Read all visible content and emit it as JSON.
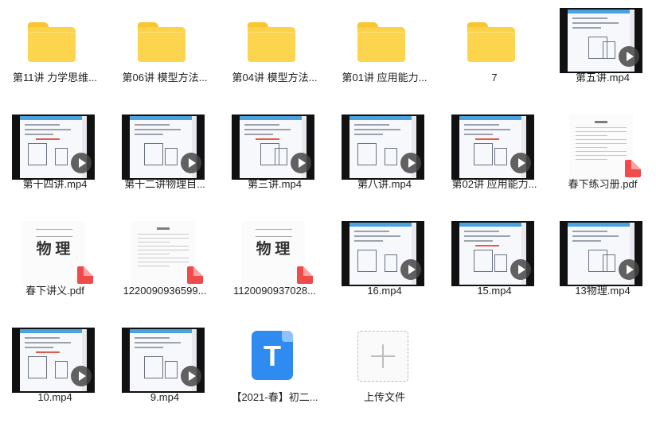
{
  "files": [
    {
      "type": "folder",
      "name": "第11讲 力学思维..."
    },
    {
      "type": "folder",
      "name": "第06讲 模型方法..."
    },
    {
      "type": "folder",
      "name": "第04讲 模型方法..."
    },
    {
      "type": "folder",
      "name": "第01讲 应用能力..."
    },
    {
      "type": "folder",
      "name": "7"
    },
    {
      "type": "video",
      "name": "第五讲.mp4"
    },
    {
      "type": "video",
      "name": "第十四讲.mp4"
    },
    {
      "type": "video",
      "name": "第十二讲物理目..."
    },
    {
      "type": "video",
      "name": "第三讲.mp4"
    },
    {
      "type": "video",
      "name": "第八讲.mp4"
    },
    {
      "type": "video",
      "name": "第02讲 应用能力..."
    },
    {
      "type": "pdf",
      "name": "春下练习册.pdf",
      "cover": "",
      "cover_sub": ""
    },
    {
      "type": "pdf",
      "name": "春下讲义.pdf",
      "cover": "物 理",
      "cover_sub": ""
    },
    {
      "type": "pdf",
      "name": "1220090936599...",
      "cover": "",
      "cover_sub": ""
    },
    {
      "type": "pdf",
      "name": "1120090937028...",
      "cover": "物 理",
      "cover_sub": ""
    },
    {
      "type": "video",
      "name": "16.mp4"
    },
    {
      "type": "video",
      "name": "15.mp4"
    },
    {
      "type": "video",
      "name": "13物理.mp4"
    },
    {
      "type": "video",
      "name": "10.mp4"
    },
    {
      "type": "video",
      "name": "9.mp4"
    },
    {
      "type": "doc",
      "name": "【2021-春】初二...",
      "letter": "T"
    },
    {
      "type": "upload",
      "name": "上传文件"
    }
  ],
  "colors": {
    "folder": "#fcd24a",
    "pdf_badge": "#f04a4a",
    "doc": "#2f8bf0"
  },
  "icons": {
    "folder": "folder-icon",
    "video": "video-play-icon",
    "pdf": "pdf-icon",
    "doc": "text-doc-icon",
    "upload": "plus-icon"
  }
}
